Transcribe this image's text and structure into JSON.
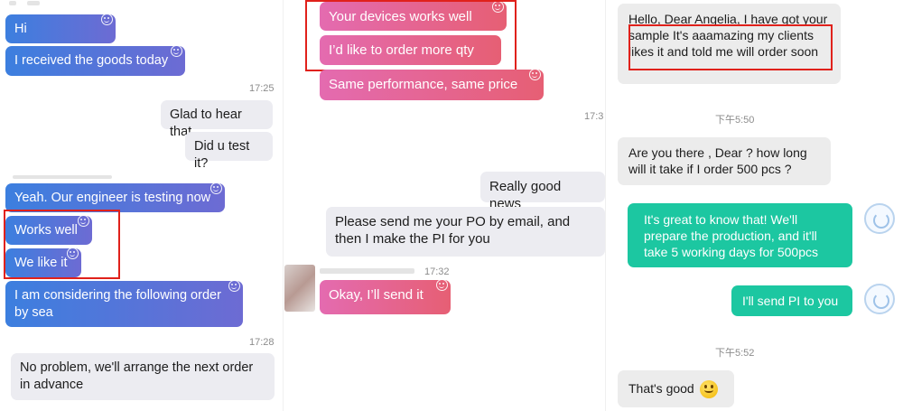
{
  "panel_left": {
    "messages": [
      {
        "text": "Hi"
      },
      {
        "text": "I received the goods today"
      },
      {
        "text": "Glad to hear that"
      },
      {
        "text": "Did u test it?"
      },
      {
        "text": "Yeah. Our engineer is testing now"
      },
      {
        "text": "Works well"
      },
      {
        "text": "We like it"
      },
      {
        "text": "I am considering the following order by sea"
      },
      {
        "text": "No problem, we'll arrange the next order in advance"
      }
    ],
    "times": [
      "17:25",
      "17:28"
    ]
  },
  "panel_middle": {
    "messages": [
      {
        "text": "Your devices works well"
      },
      {
        "text": "I’d like to order more qty"
      },
      {
        "text": "Same performance, same price"
      },
      {
        "text": "Really good news"
      },
      {
        "text": "Please send me your PO by email, and then I make the PI for you"
      },
      {
        "text": "Okay, I’ll send it"
      }
    ],
    "times": [
      "17:3",
      "17:32"
    ]
  },
  "panel_right": {
    "messages": [
      {
        "text": "Hello, Dear Angelia, I have got your sample  It's aaamazing my clients likes it and told me will order soon"
      },
      {
        "text": "Are you there , Dear ?  how long will it take if I order 500 pcs ?"
      },
      {
        "text": "It's great to know that! We'll prepare the production, and it'll take 5 working days for 500pcs"
      },
      {
        "text": "I'll send PI to you"
      },
      {
        "text": "That's good"
      }
    ],
    "times": [
      "下午5:50",
      "下午5:52"
    ]
  },
  "colors": {
    "blue_bubble": "#3c7fdf",
    "pink_bubble": "#e65f74",
    "green_bubble": "#1cc7a1",
    "highlight_box": "#e0211b"
  },
  "icons": [
    "smile-icon",
    "smiley-emoji-icon",
    "avatar-icon"
  ]
}
